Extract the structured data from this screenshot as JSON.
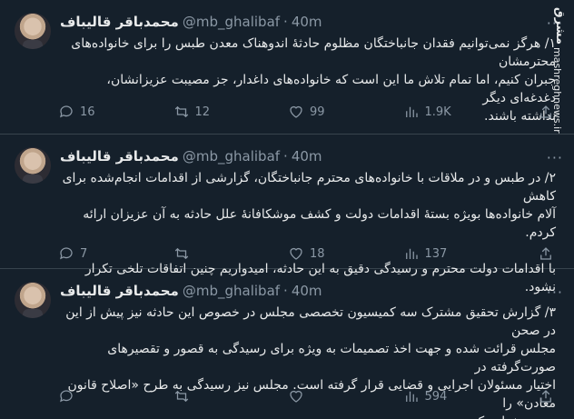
{
  "tweets": [
    {
      "name": "محمدباقر قالیباف",
      "handle": "@mb_ghalibaf",
      "dot": "·",
      "time": "40m",
      "text": "۱/ هرگز نمی‌توانیم فقدان جانباختگان مظلوم حادثهٔ اندوهناک معدن طبس را برای خانواده‌های محترمشان\nجبران کنیم، اما تمام تلاش ما این است که خانواده‌های داغدار، جز مصیبت عزیزانشان، دغدغه‌ای دیگر\nنداشته باشند.",
      "stats": {
        "replies": "16",
        "retweets": "12",
        "likes": "99",
        "views": "1.9K"
      }
    },
    {
      "name": "محمدباقر قالیباف",
      "handle": "@mb_ghalibaf",
      "dot": "·",
      "time": "40m",
      "text": "۲/ در طبس و در ملاقات با خانواده‌های محترم جانباختگان، گزارشی از اقدامات انجام‌شده برای کاهش\nآلام خانواده‌ها بویژه بستهٔ اقدامات دولت و کشف موشکافانهٔ علل حادثه به آن عزیزان ارائه کردم.\n\nبا اقدامات دولت محترم و رسیدگی دقیق به این حادثه، امیدواریم چنین اتفاقات تلخی تکرار نشود.",
      "stats": {
        "replies": "7",
        "retweets": "",
        "likes": "18",
        "views": "137"
      }
    },
    {
      "name": "محمدباقر قالیباف",
      "handle": "@mb_ghalibaf",
      "dot": "·",
      "time": "40m",
      "text": "۳/ گزارش تحقیق مشترک سه کمیسیون تخصصی مجلس در خصوص این حادثه نیز پیش از این در صحن\nمجلس قرائت شده و جهت اخذ تصمیمات به ویژه برای رسیدگی به قصور و تقصیرهای صورت‌گرفته در\nاختیار مسئولان اجرایی و قضایی قرار گرفته است. مجلس نیز رسیدگی به طرح «اصلاح قانون معادن» را\nتسریع خواهد کرد.",
      "stats": {
        "replies": "",
        "retweets": "",
        "likes": "",
        "views": "594"
      }
    }
  ],
  "watermark": {
    "logo": "مشرق",
    "url": "mashreghnews.ir"
  },
  "colors": {
    "background": "#15202b",
    "text": "#e7e9ea",
    "muted": "#8b98a5",
    "divider": "#38444d"
  }
}
